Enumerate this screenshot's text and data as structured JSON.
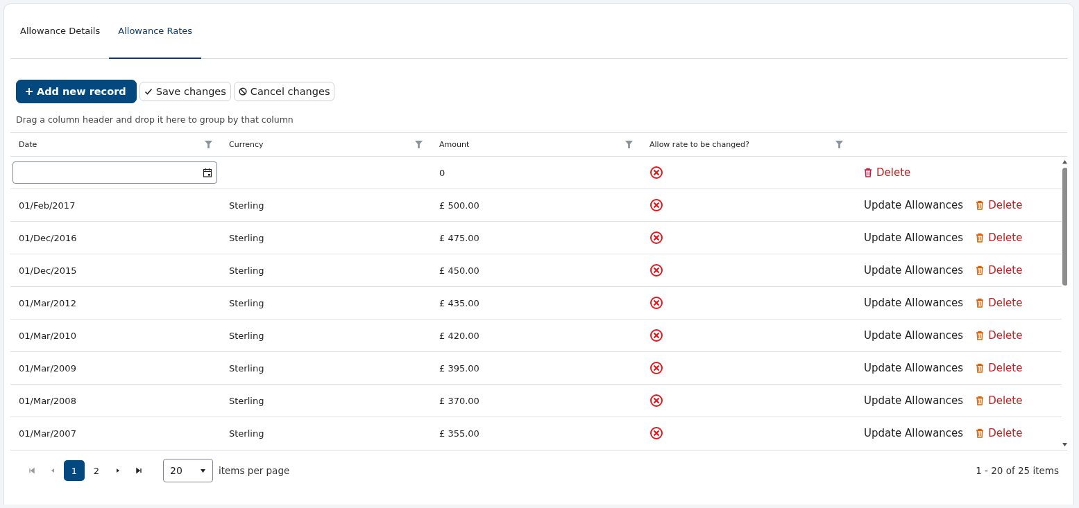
{
  "tabs": [
    {
      "label": "Allowance Details",
      "selected": false
    },
    {
      "label": "Allowance Rates",
      "selected": true
    }
  ],
  "toolbar": [
    {
      "kind": "primary",
      "label": "Add new record"
    },
    {
      "kind": "save",
      "label": "Save changes"
    },
    {
      "kind": "cancel",
      "label": "Cancel changes"
    }
  ],
  "group_hint": "Drag a column header and drop it here to group by that column",
  "columns": [
    "Date",
    "Currency",
    "Amount",
    "Allow rate to be changed?"
  ],
  "new_row": {
    "amount": "0",
    "allow_change": false,
    "delete_label": "Delete"
  },
  "rows": [
    {
      "date": "01/Feb/2017",
      "currency": "Sterling",
      "amount": "£ 500.00",
      "allow_change": false,
      "update_label": "Update Allowances",
      "delete_label": "Delete"
    },
    {
      "date": "01/Dec/2016",
      "currency": "Sterling",
      "amount": "£ 475.00",
      "allow_change": false,
      "update_label": "Update Allowances",
      "delete_label": "Delete"
    },
    {
      "date": "01/Dec/2015",
      "currency": "Sterling",
      "amount": "£ 450.00",
      "allow_change": false,
      "update_label": "Update Allowances",
      "delete_label": "Delete"
    },
    {
      "date": "01/Mar/2012",
      "currency": "Sterling",
      "amount": "£ 435.00",
      "allow_change": false,
      "update_label": "Update Allowances",
      "delete_label": "Delete"
    },
    {
      "date": "01/Mar/2010",
      "currency": "Sterling",
      "amount": "£ 420.00",
      "allow_change": false,
      "update_label": "Update Allowances",
      "delete_label": "Delete"
    },
    {
      "date": "01/Mar/2009",
      "currency": "Sterling",
      "amount": "£ 395.00",
      "allow_change": false,
      "update_label": "Update Allowances",
      "delete_label": "Delete"
    },
    {
      "date": "01/Mar/2008",
      "currency": "Sterling",
      "amount": "£ 370.00",
      "allow_change": false,
      "update_label": "Update Allowances",
      "delete_label": "Delete"
    },
    {
      "date": "01/Mar/2007",
      "currency": "Sterling",
      "amount": "£ 355.00",
      "allow_change": false,
      "update_label": "Update Allowances",
      "delete_label": "Delete"
    }
  ],
  "pager": {
    "first_disabled": true,
    "prev_disabled": true,
    "pages": [
      {
        "label": "1",
        "selected": true
      },
      {
        "label": "2",
        "selected": false
      }
    ],
    "page_size": "20",
    "page_size_label": "items per page",
    "summary": "1 - 20 of 25 items"
  }
}
